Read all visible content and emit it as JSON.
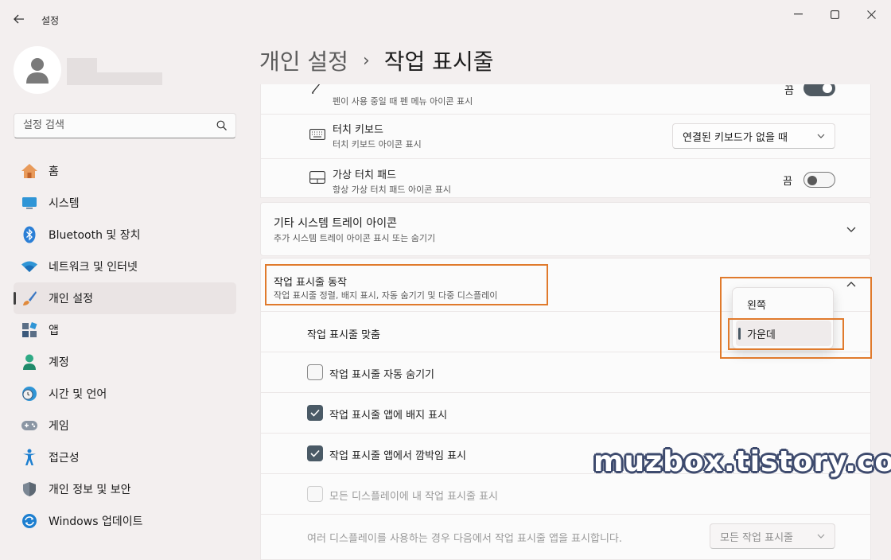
{
  "window": {
    "app_title": "설정"
  },
  "user": {
    "name": ""
  },
  "search": {
    "placeholder": "설정 검색"
  },
  "nav": {
    "items": [
      {
        "label": "홈",
        "icon": "home-icon"
      },
      {
        "label": "시스템",
        "icon": "display-icon"
      },
      {
        "label": "Bluetooth 및 장치",
        "icon": "bluetooth-icon"
      },
      {
        "label": "네트워크 및 인터넷",
        "icon": "wifi-icon"
      },
      {
        "label": "개인 설정",
        "icon": "brush-icon",
        "active": true
      },
      {
        "label": "앱",
        "icon": "apps-icon"
      },
      {
        "label": "계정",
        "icon": "account-icon"
      },
      {
        "label": "시간 및 언어",
        "icon": "clock-globe-icon"
      },
      {
        "label": "게임",
        "icon": "gamepad-icon"
      },
      {
        "label": "접근성",
        "icon": "accessibility-icon"
      },
      {
        "label": "개인 정보 및 보안",
        "icon": "shield-icon"
      },
      {
        "label": "Windows 업데이트",
        "icon": "update-icon"
      }
    ]
  },
  "header": {
    "parent": "개인 설정",
    "separator": "›",
    "current": "작업 표시줄"
  },
  "pen": {
    "subtitle": "펜이 사용 중일 때 펜 메뉴 아이콘 표시",
    "state": "끔"
  },
  "touch_keyboard": {
    "title": "터치 키보드",
    "subtitle": "터치 키보드 아이콘 표시",
    "value": "연결된 키보드가 없을 때"
  },
  "touchpad": {
    "title": "가상 터치 패드",
    "subtitle": "항상 가상 터치 패드 아이콘 표시",
    "state": "끔"
  },
  "other_tray": {
    "title": "기타 시스템 트레이 아이콘",
    "subtitle": "추가 시스템 트레이 아이콘 표시 또는 숨기기"
  },
  "behaviors": {
    "title": "작업 표시줄 동작",
    "subtitle": "작업 표시줄 정렬, 배지 표시, 자동 숨기기 및 다중 디스플레이",
    "alignment_label": "작업 표시줄 맞춤",
    "alignment_options": [
      "왼쪽",
      "가운데"
    ],
    "alignment_selected": "가운데",
    "auto_hide": {
      "label": "작업 표시줄 자동 숨기기",
      "checked": false
    },
    "badges": {
      "label": "작업 표시줄 앱에 배지 표시",
      "checked": true
    },
    "flashing": {
      "label": "작업 표시줄 앱에서 깜박임 표시",
      "checked": true
    },
    "all_displays": {
      "label": "모든 디스플레이에 내 작업 표시줄 표시",
      "checked": false,
      "disabled": true
    },
    "multi_display_label": "여러 디스플레이를 사용하는 경우 다음에서 작업 표시줄 앱을 표시합니다.",
    "multi_display_value": "모든 작업 표시줄"
  },
  "watermark": "muzbox.tistory.com",
  "colors": {
    "accent": "#4a5a66",
    "highlight": "#e07a2c",
    "background": "#f3efef",
    "card": "#fbfbfb"
  }
}
